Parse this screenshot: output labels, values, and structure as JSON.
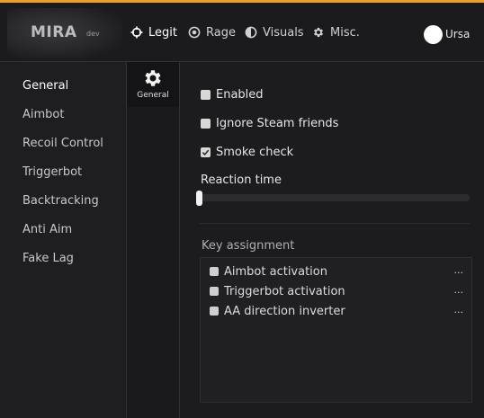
{
  "header": {
    "logo_text": "MIRA",
    "logo_sub": "dev",
    "tabs": [
      {
        "label": "Legit",
        "icon": "crosshair-icon",
        "active": true
      },
      {
        "label": "Rage",
        "icon": "target-icon",
        "active": false
      },
      {
        "label": "Visuals",
        "icon": "half-circle-icon",
        "active": false
      },
      {
        "label": "Misc.",
        "icon": "gear-icon",
        "active": false
      }
    ],
    "user": {
      "name": "Ursa"
    },
    "accent_color": "#f0a020"
  },
  "sidebar": {
    "items": [
      {
        "label": "General",
        "active": true
      },
      {
        "label": "Aimbot"
      },
      {
        "label": "Recoil Control"
      },
      {
        "label": "Triggerbot"
      },
      {
        "label": "Backtracking"
      },
      {
        "label": "Anti Aim"
      },
      {
        "label": "Fake Lag"
      }
    ]
  },
  "subnav": {
    "items": [
      {
        "label": "General",
        "icon": "gear-icon",
        "active": true
      }
    ]
  },
  "options": {
    "enabled": {
      "label": "Enabled",
      "checked": false
    },
    "ignore_steam": {
      "label": "Ignore Steam friends",
      "checked": false
    },
    "smoke_check": {
      "label": "Smoke check",
      "checked": true
    }
  },
  "reaction_time": {
    "label": "Reaction time",
    "value": 0
  },
  "key_assignment": {
    "label": "Key assignment",
    "items": [
      {
        "label": "Aimbot activation",
        "checked": false,
        "more": "..."
      },
      {
        "label": "Triggerbot activation",
        "checked": false,
        "more": "..."
      },
      {
        "label": "AA direction inverter",
        "checked": false,
        "more": "..."
      }
    ]
  }
}
